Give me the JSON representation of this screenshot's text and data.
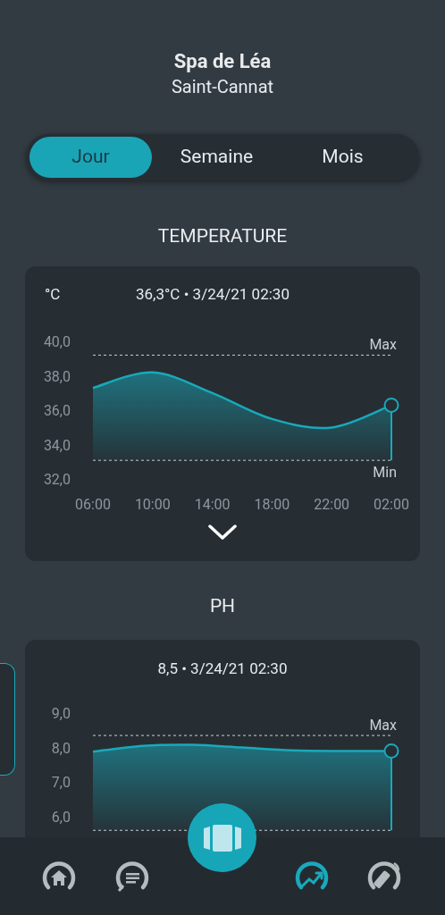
{
  "header": {
    "title": "Spa de Léa",
    "subtitle": "Saint-Cannat"
  },
  "tabs": [
    {
      "label": "Jour",
      "selected": true
    },
    {
      "label": "Semaine",
      "selected": false
    },
    {
      "label": "Mois",
      "selected": false
    }
  ],
  "sections": [
    {
      "title": "TEMPERATURE",
      "unit": "°C",
      "reading": "36,3°C • 3/24/21 02:30",
      "chart_data": {
        "type": "area",
        "categories": [
          "06:00",
          "10:00",
          "14:00",
          "18:00",
          "22:00",
          "02:00"
        ],
        "series": [
          {
            "color": "#19a9bb",
            "values": [
              37.3,
              38.2,
              37.0,
              35.5,
              35.0,
              36.3
            ]
          }
        ],
        "yticks": [
          {
            "value": 32,
            "label": "32,0"
          },
          {
            "value": 34,
            "label": "34,0"
          },
          {
            "value": 36,
            "label": "36,0"
          },
          {
            "value": 38,
            "label": "38,0"
          },
          {
            "value": 40,
            "label": "40,0"
          }
        ],
        "ylim": [
          32,
          40
        ],
        "ref_lines": [
          {
            "axis": "y",
            "value": 39.2,
            "label": "Max"
          },
          {
            "axis": "y",
            "value": 33.1,
            "label": "Min"
          }
        ]
      }
    },
    {
      "title": "PH",
      "reading": "8,5 • 3/24/21 02:30",
      "chart_data": {
        "type": "area",
        "series": [
          {
            "color": "#19a9bb",
            "values": [
              7.88,
              8.05,
              8.08,
              8.0,
              7.92,
              7.9,
              7.9
            ]
          }
        ],
        "yticks": [
          {
            "value": 6,
            "label": "6,0"
          },
          {
            "value": 7,
            "label": "7,0"
          },
          {
            "value": 8,
            "label": "8,0"
          },
          {
            "value": 9,
            "label": "9,0"
          }
        ],
        "ylim": [
          5.6,
          9
        ],
        "ref_lines": [
          {
            "axis": "y",
            "value": 8.35,
            "label": "Max"
          },
          {
            "axis": "y",
            "value": 5.6
          }
        ]
      }
    }
  ],
  "nav": [
    {
      "kind": "home",
      "selected": false
    },
    {
      "kind": "messages",
      "selected": false
    },
    {
      "kind": "stats",
      "selected": true
    },
    {
      "kind": "remote",
      "selected": false
    }
  ]
}
